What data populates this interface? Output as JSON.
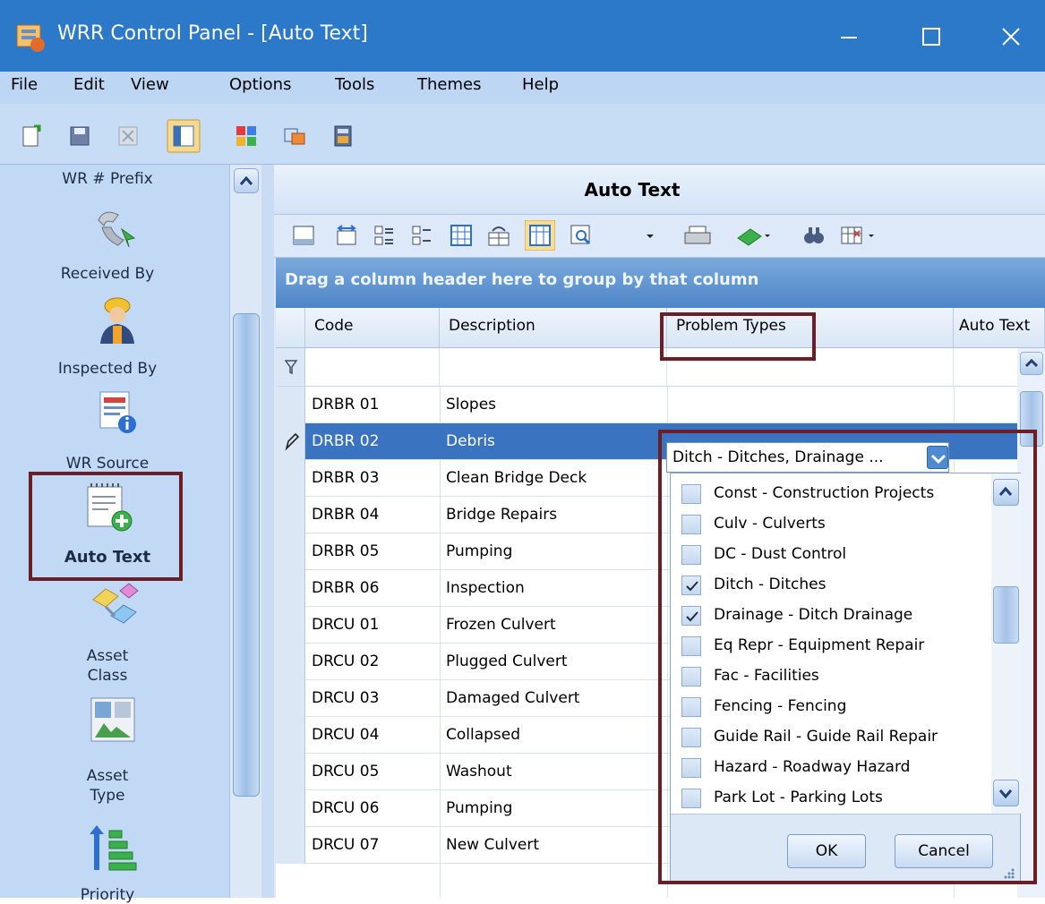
{
  "window": {
    "title": "WRR Control Panel - [Auto Text]"
  },
  "menu": [
    "File",
    "Edit",
    "View",
    "Options",
    "Tools",
    "Themes",
    "Help"
  ],
  "nav": {
    "items": [
      {
        "label": "WR # Prefix",
        "icon": "prefix-icon"
      },
      {
        "label": "Received By",
        "icon": "phone-icon"
      },
      {
        "label": "Inspected By",
        "icon": "worker-icon"
      },
      {
        "label": "WR Source",
        "icon": "document-info-icon"
      },
      {
        "label": "Auto Text",
        "icon": "notepad-add-icon"
      },
      {
        "label": "Asset\nClass",
        "icon": "shapes-icon"
      },
      {
        "label": "Asset\nType",
        "icon": "asset-type-icon"
      },
      {
        "label": "Priority",
        "icon": "priority-icon"
      }
    ]
  },
  "main": {
    "title": "Auto Text",
    "group_hint": "Drag a column header here to group by that column",
    "columns": [
      "Code",
      "Description",
      "Problem Types",
      "Auto Text"
    ],
    "rows": [
      {
        "code": "DRBR 01",
        "description": "Slopes"
      },
      {
        "code": "DRBR 02",
        "description": "Debris",
        "problem_types": "Ditch  -  Ditches, Drainage ..."
      },
      {
        "code": "DRBR 03",
        "description": "Clean Bridge Deck"
      },
      {
        "code": "DRBR 04",
        "description": "Bridge Repairs"
      },
      {
        "code": "DRBR 05",
        "description": "Pumping"
      },
      {
        "code": "DRBR 06",
        "description": "Inspection"
      },
      {
        "code": "DRCU 01",
        "description": "Frozen Culvert"
      },
      {
        "code": "DRCU 02",
        "description": "Plugged Culvert"
      },
      {
        "code": "DRCU 03",
        "description": "Damaged Culvert"
      },
      {
        "code": "DRCU 04",
        "description": "Collapsed"
      },
      {
        "code": "DRCU 05",
        "description": "Washout"
      },
      {
        "code": "DRCU 06",
        "description": "Pumping"
      },
      {
        "code": "DRCU 07",
        "description": "New Culvert"
      }
    ],
    "selected_row_index": 1
  },
  "dropdown": {
    "options": [
      {
        "label": "Const  -  Construction Projects",
        "checked": false
      },
      {
        "label": "Culv  -  Culverts",
        "checked": false
      },
      {
        "label": "DC  -  Dust Control",
        "checked": false
      },
      {
        "label": "Ditch  -  Ditches",
        "checked": true
      },
      {
        "label": "Drainage  -  Ditch Drainage",
        "checked": true
      },
      {
        "label": "Eq Repr  -  Equipment Repair",
        "checked": false
      },
      {
        "label": "Fac  -  Facilities",
        "checked": false
      },
      {
        "label": "Fencing  -  Fencing",
        "checked": false
      },
      {
        "label": "Guide Rail  -  Guide Rail Repair",
        "checked": false
      },
      {
        "label": "Hazard  -  Roadway Hazard",
        "checked": false
      },
      {
        "label": "Park Lot  -  Parking Lots",
        "checked": false
      }
    ],
    "ok_label": "OK",
    "cancel_label": "Cancel"
  },
  "colors": {
    "titlebar": "#2b79c8",
    "menubar": "#bcd6f4",
    "selected_row": "#3a73bf",
    "highlight_box": "#6b1e26"
  }
}
